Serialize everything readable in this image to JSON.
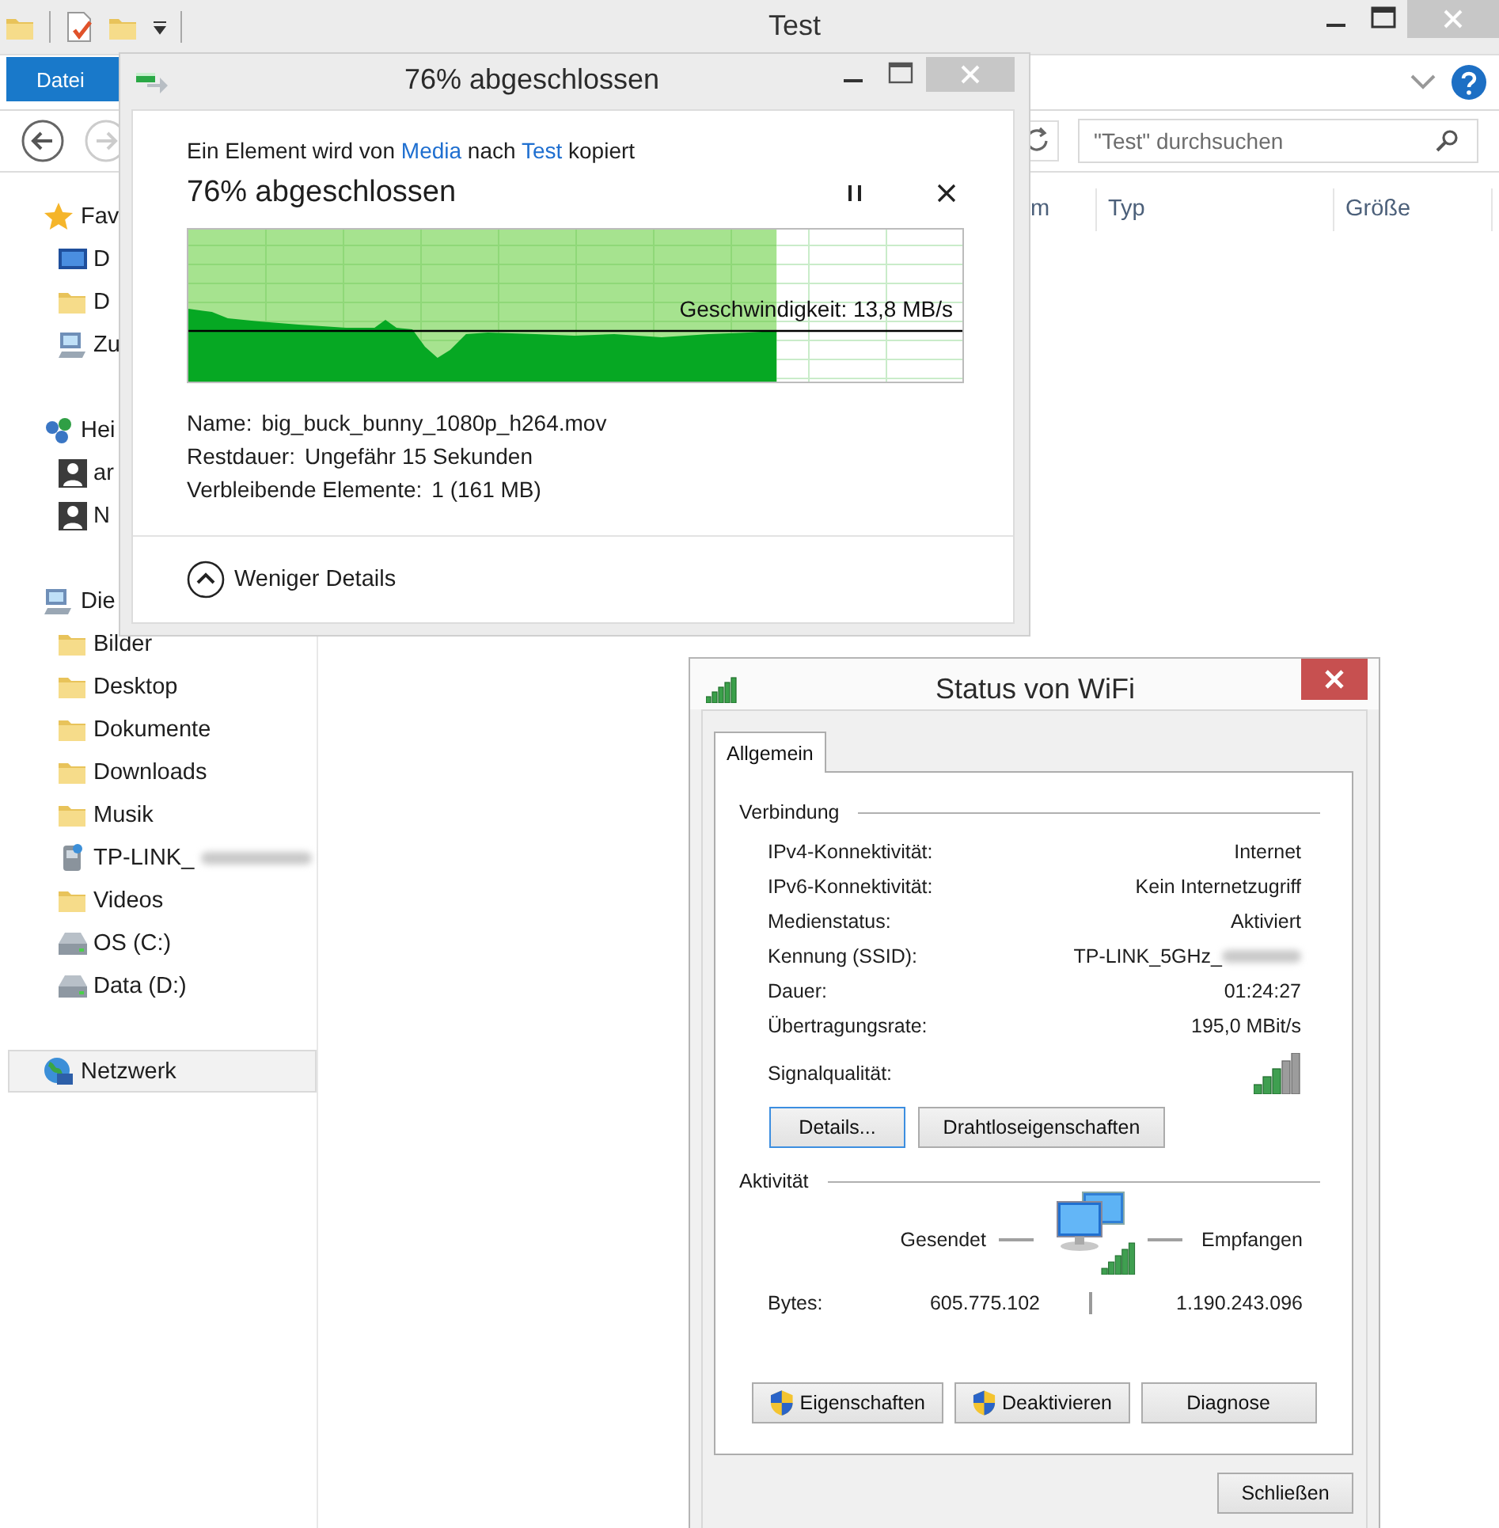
{
  "explorer": {
    "title": "Test",
    "ribbon_tab": "Datei",
    "search": {
      "placeholder": "\"Test\" durchsuchen"
    },
    "columns": [
      "m",
      "Typ",
      "Größe"
    ],
    "nav": [
      {
        "label": "Fav",
        "selected": false,
        "children": [
          {
            "label": "D",
            "selected": false
          },
          {
            "label": "D",
            "selected": false
          },
          {
            "label": "Zu",
            "selected": false
          }
        ]
      },
      {
        "label": "Hei",
        "selected": false,
        "children": [
          {
            "label": "ar",
            "selected": false
          },
          {
            "label": "N",
            "selected": false
          }
        ]
      },
      {
        "label": "Die",
        "selected": false,
        "children": [
          {
            "label": "Bilder",
            "selected": false
          },
          {
            "label": "Desktop",
            "selected": false
          },
          {
            "label": "Dokumente",
            "selected": false
          },
          {
            "label": "Downloads",
            "selected": false
          },
          {
            "label": "Musik",
            "selected": false
          },
          {
            "label": "TP-LINK_",
            "selected": false,
            "redacted": true
          },
          {
            "label": "Videos",
            "selected": false
          },
          {
            "label": "OS (C:)",
            "selected": false
          },
          {
            "label": "Data (D:)",
            "selected": false
          }
        ]
      },
      {
        "label": "Netzwerk",
        "selected": true
      }
    ]
  },
  "copy_dialog": {
    "title": "76% abgeschlossen",
    "message": [
      {
        "kind": "text",
        "text": "Ein Element wird von "
      },
      {
        "kind": "link",
        "text": "Media"
      },
      {
        "kind": "text",
        "text": " nach "
      },
      {
        "kind": "link",
        "text": "Test"
      },
      {
        "kind": "text",
        "text": " kopiert"
      }
    ],
    "heading": "76% abgeschlossen",
    "progress": {
      "level": 0.76
    },
    "speed": "Geschwindigkeit: 13,8 MB/s",
    "details": [
      {
        "label": "Name:",
        "value": "big_buck_bunny_1080p_h264.mov"
      },
      {
        "label": "Restdauer:",
        "value": "Ungefähr 15 Sekunden"
      },
      {
        "label": "Verbleibende Elemente:",
        "value": "1 (161 MB)"
      }
    ],
    "toggle": "Weniger Details"
  },
  "wifi_dialog": {
    "title": "Status von WiFi",
    "tabs": [
      {
        "label": "Allgemein",
        "selected": true
      }
    ],
    "connection": {
      "heading": "Verbindung",
      "rows": [
        {
          "kind": "text",
          "label": "IPv4-Konnektivität:",
          "value": "Internet"
        },
        {
          "kind": "text",
          "label": "IPv6-Konnektivität:",
          "value": "Kein Internetzugriff"
        },
        {
          "kind": "text",
          "label": "Medienstatus:",
          "value": "Aktiviert"
        },
        {
          "kind": "text",
          "label": "Kennung (SSID):",
          "value": "TP-LINK_5GHz_",
          "redacted": true
        },
        {
          "kind": "text",
          "label": "Dauer:",
          "value": "01:24:27"
        },
        {
          "kind": "text",
          "label": "Übertragungsrate:",
          "value": "195,0 MBit/s"
        },
        {
          "kind": "signal",
          "label": "Signalqualität:"
        }
      ]
    },
    "buttons": [
      {
        "label": "Details...",
        "focused": true
      },
      {
        "label": "Drahtloseigenschaften",
        "focused": false
      }
    ],
    "activity": {
      "heading": "Aktivität",
      "sent_label": "Gesendet",
      "received_label": "Empfangen",
      "bytes_label": "Bytes:",
      "sent": "605.775.102",
      "received": "1.190.243.096"
    },
    "actions": [
      {
        "label": "Eigenschaften",
        "shield": true
      },
      {
        "label": "Deaktivieren",
        "shield": true
      },
      {
        "label": "Diagnose",
        "shield": false
      }
    ],
    "close_button": "Schließen"
  }
}
